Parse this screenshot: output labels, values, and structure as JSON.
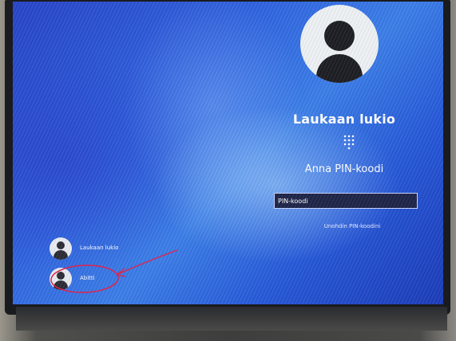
{
  "lock_screen": {
    "selected_user": "Laukaan lukio",
    "pin_prompt": "Anna PIN-koodi",
    "pin_placeholder": "PIN-koodi",
    "forgot_pin_link": "Unohdin PIN-koodini",
    "pin_icon": "keypad-icon",
    "users": [
      {
        "name": "Laukaan lukio",
        "icon": "user-avatar-icon"
      },
      {
        "name": "Abitti",
        "icon": "user-avatar-icon"
      }
    ]
  },
  "annotation": {
    "color": "#e0234b",
    "marks": "circle-and-arrow-around-abitti"
  },
  "colors": {
    "screen_blue": "#2f63e0",
    "input_bg": "#1d2448",
    "text": "#ffffff"
  }
}
